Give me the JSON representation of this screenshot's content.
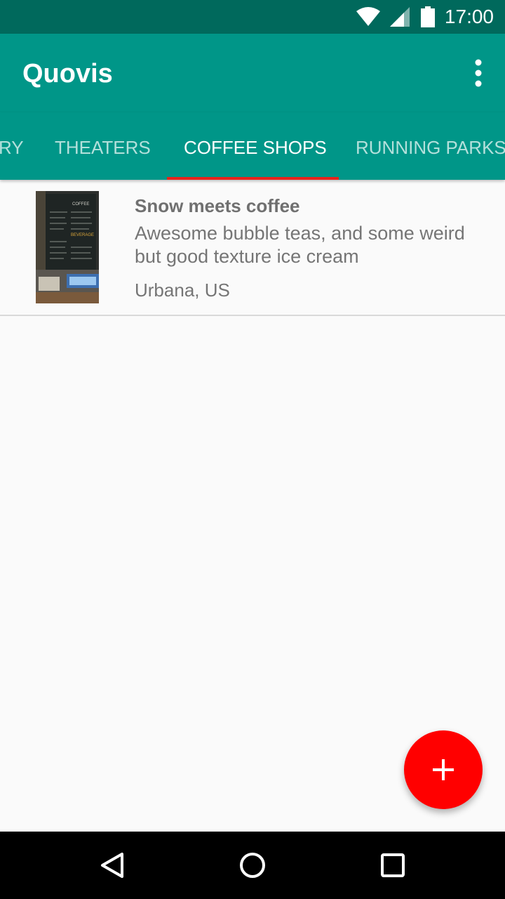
{
  "status_bar": {
    "time": "17:00",
    "icons": [
      "wifi-icon",
      "signal-icon",
      "battery-icon"
    ]
  },
  "app_bar": {
    "title": "Quovis",
    "overflow_icon": "more-vert-icon"
  },
  "tabs": [
    {
      "label": "RY",
      "active": false
    },
    {
      "label": "THEATERS",
      "active": false
    },
    {
      "label": "COFFEE SHOPS",
      "active": true
    },
    {
      "label": "RUNNING PARKS",
      "active": false
    }
  ],
  "list": {
    "items": [
      {
        "title": "Snow meets coffee",
        "description": "Awesome bubble teas, and some weird but good texture ice cream",
        "location": "Urbana, US",
        "thumbnail_text": [
          "COFFEE",
          "BEVERAGE"
        ]
      }
    ]
  },
  "fab": {
    "icon": "add-icon"
  },
  "nav_bar": {
    "icons": [
      "back-icon",
      "home-icon",
      "recents-icon"
    ]
  },
  "colors": {
    "status_bar": "#00695c",
    "primary": "#009688",
    "tab_indicator": "#e8231b",
    "fab": "#ff0000"
  }
}
